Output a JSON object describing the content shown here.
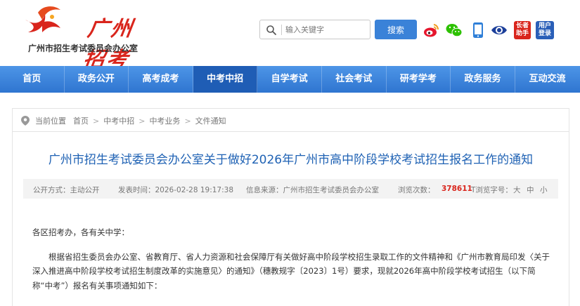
{
  "header": {
    "logo_text": "广州招考",
    "org_name": "广州市招生考试委员会办公室",
    "search": {
      "placeholder": "输入关键字",
      "button_label": "搜索"
    },
    "share": {
      "wzzs_label": "长者助手",
      "login_label": "用户登录"
    },
    "colors": {
      "brand_red": "#d9251c",
      "nav_blue": "#3a82d8",
      "title_blue": "#1f62b4"
    }
  },
  "nav": {
    "items": [
      {
        "label": "首页"
      },
      {
        "label": "政务公开"
      },
      {
        "label": "高考成考"
      },
      {
        "label": "中考中招"
      },
      {
        "label": "自学考试"
      },
      {
        "label": "社会考试"
      },
      {
        "label": "研考学考"
      },
      {
        "label": "政务服务"
      },
      {
        "label": "互动交流"
      }
    ],
    "active_index": 3
  },
  "breadcrumb": {
    "label": "当前位置",
    "items": [
      "首页",
      "中考中招",
      "中考业务",
      "文件通知"
    ]
  },
  "article": {
    "title": "广州市招生考试委员会办公室关于做好2026年广州市高中阶段学校考试招生报名工作的通知",
    "meta": {
      "disclosure": "公开方式：主动公开",
      "time": "发表时间：2026-02-28 19:17:38",
      "source": "信息来源：广州市招生考试委员会办公室",
      "views_label": "浏览次数：",
      "views": "378611",
      "font_label": "T浏览字号：",
      "font_sizes": [
        "大",
        "中",
        "小"
      ]
    },
    "salutation": "各区招考办，各有关中学：",
    "paragraph1": "根据省招生委员会办公室、省教育厅、省人力资源和社会保障厅有关做好高中阶段学校招生录取工作的文件精神和《广州市教育局印发〈关于深入推进高中阶段学校考试招生制度改革的实施意见〉的通知》（穗教规字〔2023〕1号）要求，现就2026年高中阶段学校考试招生（以下简称“中考”）报名有关事项通知如下："
  }
}
